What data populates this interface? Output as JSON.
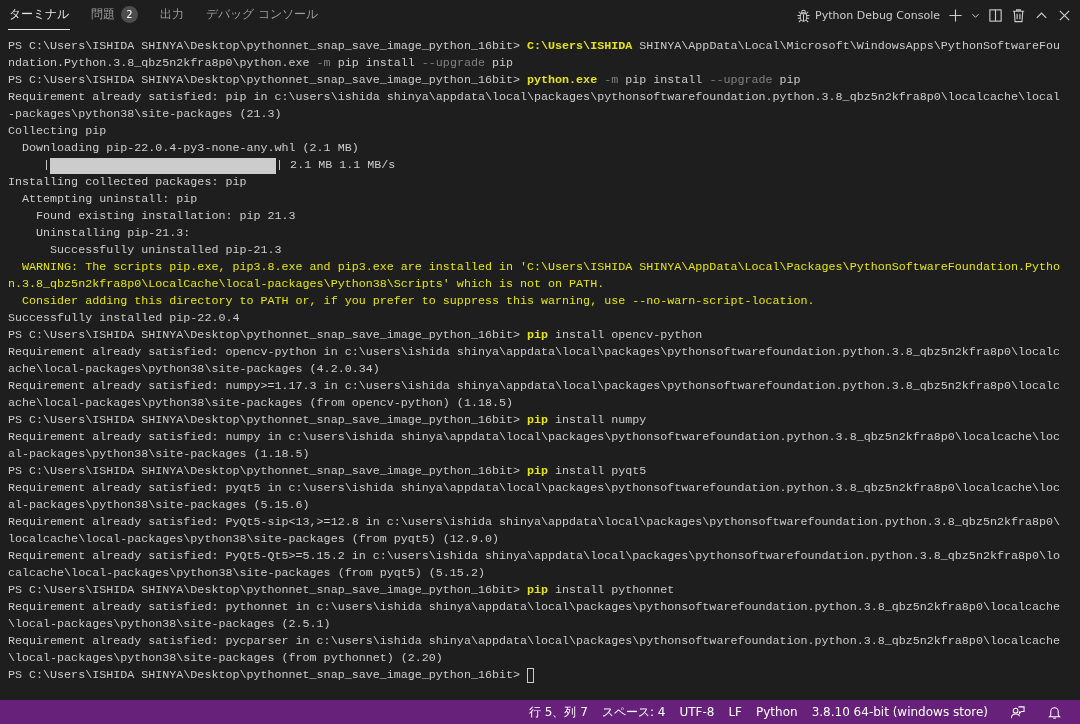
{
  "panel_tabs": [
    {
      "label": "ターミナル",
      "selected": true
    },
    {
      "label": "問題",
      "selected": false,
      "badge": "2"
    },
    {
      "label": "出力",
      "selected": false
    },
    {
      "label": "デバッグ コンソール",
      "selected": false
    }
  ],
  "terminal_name": "Python Debug Console",
  "lines": [
    [
      {
        "kind": "plain",
        "text": "PS C:\\Users\\ISHIDA SHINYA\\Desktop\\pythonnet_snap_save_image_python_16bit> "
      },
      {
        "kind": "cmd",
        "text": "C:\\Users\\ISHIDA"
      },
      {
        "kind": "plain",
        "text": " SHINYA\\AppData\\Local\\Microsoft\\WindowsApps\\PythonSoftwareFou"
      }
    ],
    [
      {
        "kind": "plain",
        "text": "ndation.Python.3.8_qbz5n2kfra8p0\\python.exe "
      },
      {
        "kind": "flag",
        "text": "-m"
      },
      {
        "kind": "plain",
        "text": " pip install "
      },
      {
        "kind": "flag",
        "text": "--upgrade"
      },
      {
        "kind": "plain",
        "text": " pip"
      }
    ],
    [
      {
        "kind": "plain",
        "text": "PS C:\\Users\\ISHIDA SHINYA\\Desktop\\pythonnet_snap_save_image_python_16bit> "
      },
      {
        "kind": "cmd",
        "text": "python.exe"
      },
      {
        "kind": "flag",
        "text": " -m"
      },
      {
        "kind": "plain",
        "text": " pip install "
      },
      {
        "kind": "flag",
        "text": "--upgrade"
      },
      {
        "kind": "plain",
        "text": " pip"
      }
    ],
    [
      {
        "kind": "plain",
        "text": "Requirement already satisfied: pip in c:\\users\\ishida shinya\\appdata\\local\\packages\\pythonsoftwarefoundation.python.3.8_qbz5n2kfra8p0\\localcache\\local"
      }
    ],
    [
      {
        "kind": "plain",
        "text": "-packages\\python38\\site-packages (21.3)"
      }
    ],
    [
      {
        "kind": "plain",
        "text": "Collecting pip"
      }
    ],
    [
      {
        "kind": "plain",
        "text": "  Downloading pip-22.0.4-py3-none-any.whl (2.1 MB)"
      }
    ],
    [
      {
        "kind": "plain",
        "text": "     |"
      },
      {
        "kind": "progress",
        "level": 1
      },
      {
        "kind": "plain",
        "text": "| 2.1 MB 1.1 MB/s"
      }
    ],
    [
      {
        "kind": "plain",
        "text": "Installing collected packages: pip"
      }
    ],
    [
      {
        "kind": "plain",
        "text": "  Attempting uninstall: pip"
      }
    ],
    [
      {
        "kind": "plain",
        "text": "    Found existing installation: pip 21.3"
      }
    ],
    [
      {
        "kind": "plain",
        "text": "    Uninstalling pip-21.3:"
      }
    ],
    [
      {
        "kind": "plain",
        "text": "      Successfully uninstalled pip-21.3"
      }
    ],
    [
      {
        "kind": "warn",
        "text": "  WARNING: The scripts pip.exe, pip3.8.exe and pip3.exe are installed in 'C:\\Users\\ISHIDA SHINYA\\AppData\\Local\\Packages\\PythonSoftwareFoundation.Pytho"
      }
    ],
    [
      {
        "kind": "warn",
        "text": "n.3.8_qbz5n2kfra8p0\\LocalCache\\local-packages\\Python38\\Scripts' which is not on PATH."
      }
    ],
    [
      {
        "kind": "warn",
        "text": "  Consider adding this directory to PATH or, if you prefer to suppress this warning, use --no-warn-script-location."
      }
    ],
    [
      {
        "kind": "plain",
        "text": "Successfully installed pip-22.0.4"
      }
    ],
    [
      {
        "kind": "plain",
        "text": "PS C:\\Users\\ISHIDA SHINYA\\Desktop\\pythonnet_snap_save_image_python_16bit> "
      },
      {
        "kind": "cmd",
        "text": "pip"
      },
      {
        "kind": "plain",
        "text": " install opencv-python"
      }
    ],
    [
      {
        "kind": "plain",
        "text": "Requirement already satisfied: opencv-python in c:\\users\\ishida shinya\\appdata\\local\\packages\\pythonsoftwarefoundation.python.3.8_qbz5n2kfra8p0\\localc"
      }
    ],
    [
      {
        "kind": "plain",
        "text": "ache\\local-packages\\python38\\site-packages (4.2.0.34)"
      }
    ],
    [
      {
        "kind": "plain",
        "text": "Requirement already satisfied: numpy>=1.17.3 in c:\\users\\ishida shinya\\appdata\\local\\packages\\pythonsoftwarefoundation.python.3.8_qbz5n2kfra8p0\\localc"
      }
    ],
    [
      {
        "kind": "plain",
        "text": "ache\\local-packages\\python38\\site-packages (from opencv-python) (1.18.5)"
      }
    ],
    [
      {
        "kind": "plain",
        "text": "PS C:\\Users\\ISHIDA SHINYA\\Desktop\\pythonnet_snap_save_image_python_16bit> "
      },
      {
        "kind": "cmd",
        "text": "pip"
      },
      {
        "kind": "plain",
        "text": " install numpy"
      }
    ],
    [
      {
        "kind": "plain",
        "text": "Requirement already satisfied: numpy in c:\\users\\ishida shinya\\appdata\\local\\packages\\pythonsoftwarefoundation.python.3.8_qbz5n2kfra8p0\\localcache\\loc"
      }
    ],
    [
      {
        "kind": "plain",
        "text": "al-packages\\python38\\site-packages (1.18.5)"
      }
    ],
    [
      {
        "kind": "plain",
        "text": "PS C:\\Users\\ISHIDA SHINYA\\Desktop\\pythonnet_snap_save_image_python_16bit> "
      },
      {
        "kind": "cmd",
        "text": "pip"
      },
      {
        "kind": "plain",
        "text": " install pyqt5"
      }
    ],
    [
      {
        "kind": "plain",
        "text": "Requirement already satisfied: pyqt5 in c:\\users\\ishida shinya\\appdata\\local\\packages\\pythonsoftwarefoundation.python.3.8_qbz5n2kfra8p0\\localcache\\loc"
      }
    ],
    [
      {
        "kind": "plain",
        "text": "al-packages\\python38\\site-packages (5.15.6)"
      }
    ],
    [
      {
        "kind": "plain",
        "text": "Requirement already satisfied: PyQt5-sip<13,>=12.8 in c:\\users\\ishida shinya\\appdata\\local\\packages\\pythonsoftwarefoundation.python.3.8_qbz5n2kfra8p0\\"
      }
    ],
    [
      {
        "kind": "plain",
        "text": "localcache\\local-packages\\python38\\site-packages (from pyqt5) (12.9.0)"
      }
    ],
    [
      {
        "kind": "plain",
        "text": "Requirement already satisfied: PyQt5-Qt5>=5.15.2 in c:\\users\\ishida shinya\\appdata\\local\\packages\\pythonsoftwarefoundation.python.3.8_qbz5n2kfra8p0\\lo"
      }
    ],
    [
      {
        "kind": "plain",
        "text": "calcache\\local-packages\\python38\\site-packages (from pyqt5) (5.15.2)"
      }
    ],
    [
      {
        "kind": "plain",
        "text": "PS C:\\Users\\ISHIDA SHINYA\\Desktop\\pythonnet_snap_save_image_python_16bit> "
      },
      {
        "kind": "cmd",
        "text": "pip"
      },
      {
        "kind": "plain",
        "text": " install pythonnet"
      }
    ],
    [
      {
        "kind": "plain",
        "text": "Requirement already satisfied: pythonnet in c:\\users\\ishida shinya\\appdata\\local\\packages\\pythonsoftwarefoundation.python.3.8_qbz5n2kfra8p0\\localcache"
      }
    ],
    [
      {
        "kind": "plain",
        "text": "\\local-packages\\python38\\site-packages (2.5.1)"
      }
    ],
    [
      {
        "kind": "plain",
        "text": "Requirement already satisfied: pycparser in c:\\users\\ishida shinya\\appdata\\local\\packages\\pythonsoftwarefoundation.python.3.8_qbz5n2kfra8p0\\localcache"
      }
    ],
    [
      {
        "kind": "plain",
        "text": "\\local-packages\\python38\\site-packages (from pythonnet) (2.20)"
      }
    ],
    [
      {
        "kind": "plain",
        "text": "PS C:\\Users\\ISHIDA SHINYA\\Desktop\\pythonnet_snap_save_image_python_16bit> "
      },
      {
        "kind": "cursor"
      }
    ]
  ],
  "status_bar": {
    "items": [
      "行 5、列 7",
      "スペース: 4",
      "UTF-8",
      "LF",
      "Python",
      "3.8.10 64-bit (windows store)"
    ]
  }
}
